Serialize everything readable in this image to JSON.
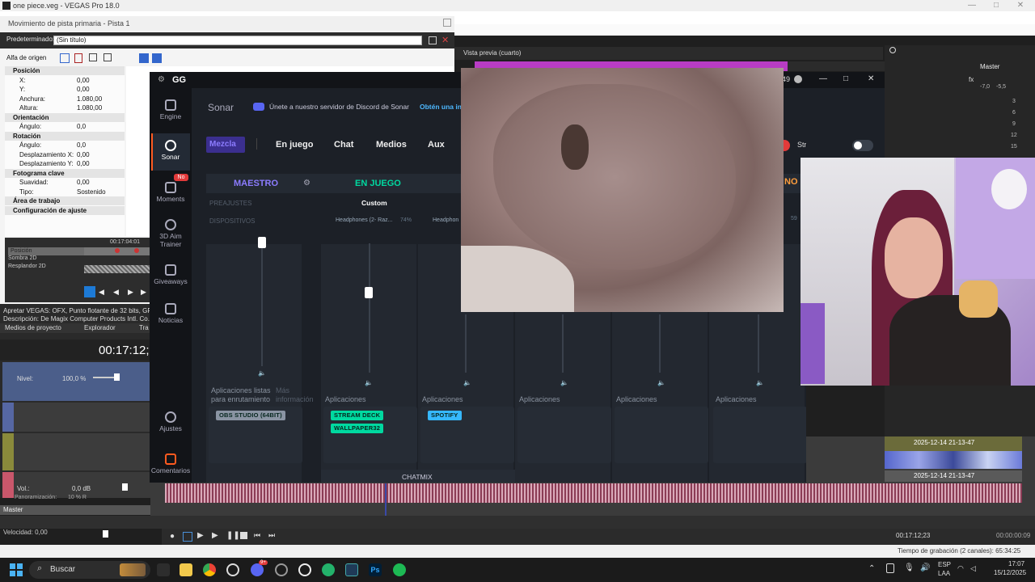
{
  "vegas": {
    "title": "one piece.veg - VEGAS Pro 18.0",
    "pan_window_title": "Movimiento de pista primaria - Pista 1",
    "preset_label": "Predeterminado:",
    "preset_value": "(Sin título)",
    "alpha_label": "Alfa de origen",
    "props": [
      {
        "type": "sec",
        "label": "Posición"
      },
      {
        "label": "X:",
        "value": "0,00"
      },
      {
        "label": "Y:",
        "value": "0,00"
      },
      {
        "label": "Anchura:",
        "value": "1.080,00"
      },
      {
        "label": "Altura:",
        "value": "1.080,00"
      },
      {
        "type": "sec",
        "label": "Orientación"
      },
      {
        "label": "Ángulo:",
        "value": "0,0"
      },
      {
        "type": "sec",
        "label": "Rotación"
      },
      {
        "label": "Ángulo:",
        "value": "0,0"
      },
      {
        "label": "Desplazamiento X:",
        "value": "0,00"
      },
      {
        "label": "Desplazamiento Y:",
        "value": "0,00"
      },
      {
        "type": "sec",
        "label": "Fotograma clave"
      },
      {
        "label": "Suavidad:",
        "value": "0,00"
      },
      {
        "label": "Tipo:",
        "value": "Sostenido"
      },
      {
        "type": "sec",
        "label": "Área de trabajo"
      },
      {
        "type": "sec",
        "label": "Configuración de ajuste"
      }
    ],
    "kf_timecode": "00:17:04:01",
    "kf_tracks": [
      "Posición",
      "Sombra 2D",
      "Resplandor 2D"
    ],
    "fx_desc1": "Apretar VEGAS: OFX, Punto flotante de 32 bits, GPU ac",
    "fx_desc2": "Descripción: De Magix Computer Products Intl. Co.",
    "tabs": [
      "Medios de proyecto",
      "Explorador",
      "Tra"
    ],
    "timecode": "00:17:12;2",
    "nivel_label": "Nivel:",
    "nivel_value": "100,0 %",
    "vol_label": "Vol.:",
    "vol_value": "0,0 dB",
    "pan_label": "Panoramización:",
    "pan_value": "10 % R",
    "master_label": "Master",
    "speed_label": "Velocidad: 0,00",
    "preview_label": "Vista previa (cuarto)",
    "mixer_master": "Master",
    "mixer_db": "-7,0",
    "mixer_db2": "-5,5",
    "mixer_scale": [
      "3",
      "6",
      "9",
      "12",
      "15"
    ],
    "clip_name": "2025-12-14 21-13-47",
    "status_tc": "00:17:12;23",
    "status_tc2": "00:00:00:09",
    "rec_time": "Tiempo de grabación (2 canales): 65:34:25"
  },
  "gg": {
    "logo": "GG",
    "sidebar": [
      {
        "label": "Engine",
        "sel": false
      },
      {
        "label": "Sonar",
        "sel": true
      },
      {
        "label": "Moments",
        "sel": false,
        "badge": "No"
      },
      {
        "label": "3D Aim Trainer",
        "sel": false
      },
      {
        "label": "Giveaways",
        "sel": false
      },
      {
        "label": "Noticias",
        "sel": false
      },
      {
        "label": "Ajustes",
        "sel": false
      },
      {
        "label": "Comentarios",
        "sel": false
      }
    ],
    "section": "Sonar",
    "discord_text": "Únete a nuestro servidor de Discord de Sonar",
    "discord_link": "Obtén una in",
    "topnum": "49",
    "streamer_mode": "Streamer mode",
    "tabs": [
      "Mezcla",
      "En juego",
      "Chat",
      "Medios",
      "Aux"
    ],
    "maestro": "MAESTRO",
    "en_juego": "EN JUEGO",
    "partial_no": "NO",
    "preajustes": "PREAJUSTES",
    "custom": "Custom",
    "dispositivos": "DISPOSITIVOS",
    "device1": "Headphones (2- Raz...",
    "device1_pct": "74%",
    "device2": "Headphon",
    "pct59": "59",
    "apps_listas": "Aplicaciones listas para enrutamiento",
    "mas_info": "Más información",
    "aplicaciones": "Aplicaciones",
    "app_obs": "OBS STUDIO (64BIT)",
    "app_stream": "STREAM DECK",
    "app_wall": "WALLPAPER32",
    "app_spot": "SPOTIFY",
    "chatmix": "CHATMIX"
  },
  "taskbar": {
    "search": "Buscar",
    "lang": "ESP",
    "lang2": "LAA",
    "time": "17:07",
    "date": "15/12/2025",
    "discord_badge": "9+"
  },
  "colors": {
    "accent": "#00d9a0",
    "sonar_purple": "#6b4cff",
    "track_video": "#4b5e8a",
    "track_audio": "#c9576b"
  }
}
